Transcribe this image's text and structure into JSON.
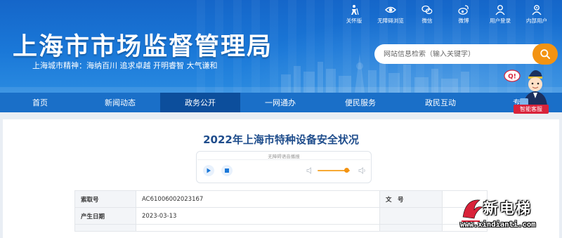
{
  "header": {
    "site_title": "上海市市场监督管理局",
    "slogan": "上海城市精神：海纳百川    追求卓越    开明睿智    大气谦和",
    "top_icons": [
      {
        "label": "关怀版",
        "icon": "elder-care-icon"
      },
      {
        "label": "无障碍浏览",
        "icon": "eye-icon"
      },
      {
        "label": "微信",
        "icon": "wechat-icon"
      },
      {
        "label": "微博",
        "icon": "weibo-icon"
      },
      {
        "label": "用户登录",
        "icon": "user-icon"
      },
      {
        "label": "内部用户",
        "icon": "internal-user-icon"
      }
    ],
    "search": {
      "placeholder": "网站信息检索（输入关键字）"
    }
  },
  "nav": {
    "items": [
      "首页",
      "新闻动态",
      "政务公开",
      "一网通办",
      "便民服务",
      "政民互动",
      "专题"
    ],
    "active_index": 2
  },
  "assistant": {
    "badge": "智能客服",
    "bubble": "Q!"
  },
  "article": {
    "title": "2022年上海市特种设备安全状况",
    "player_tip": "无障碍语音播报"
  },
  "meta": {
    "rows": [
      {
        "k1": "索取号",
        "v1": "AC61006002023167",
        "k2": "文　号",
        "v2": ""
      },
      {
        "k1": "产生日期",
        "v1": "2023-03-13",
        "k2": "",
        "v2": ""
      }
    ]
  },
  "watermark": {
    "text": "新电梯",
    "url": "www.xindianti.com"
  },
  "colors": {
    "header_blue": "#1566c9",
    "nav_blue": "#1a6fc8",
    "nav_active": "#0c4e9c",
    "accent_orange": "#f39312",
    "title_blue": "#1f4d8c"
  }
}
